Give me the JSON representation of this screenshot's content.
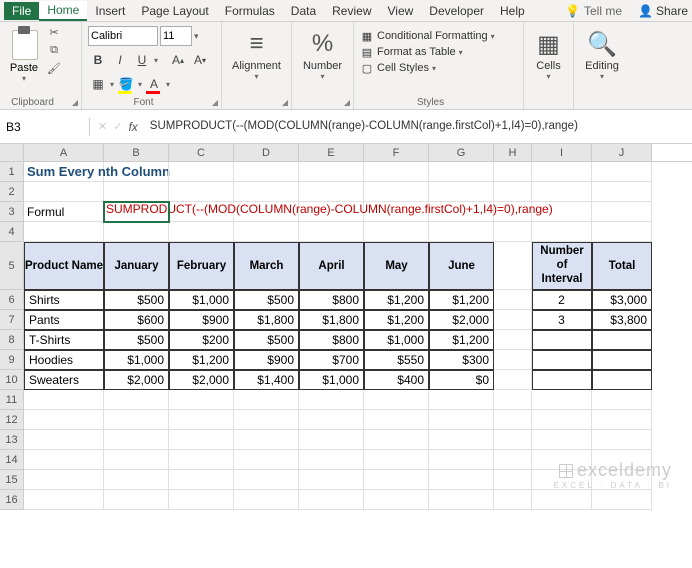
{
  "menu": {
    "file": "File",
    "home": "Home",
    "insert": "Insert",
    "pageLayout": "Page Layout",
    "formulas": "Formulas",
    "data": "Data",
    "review": "Review",
    "view": "View",
    "developer": "Developer",
    "help": "Help",
    "tellMe": "Tell me",
    "share": "Share"
  },
  "ribbon": {
    "clipboard": {
      "label": "Clipboard",
      "paste": "Paste"
    },
    "font": {
      "label": "Font",
      "name": "Calibri",
      "size": "11"
    },
    "alignment": {
      "label": "Alignment"
    },
    "number": {
      "label": "Number"
    },
    "styles": {
      "label": "Styles",
      "cond": "Conditional Formatting",
      "table": "Format as Table",
      "cell": "Cell Styles"
    },
    "cells": {
      "label": "Cells"
    },
    "editing": {
      "label": "Editing"
    }
  },
  "namebox": "B3",
  "formulaBar": "SUMPRODUCT(--(MOD(COLUMN(range)-COLUMN(range.firstCol)+1,I4)=0),range)",
  "sheet": {
    "cols": [
      "A",
      "B",
      "C",
      "D",
      "E",
      "F",
      "G",
      "H",
      "I",
      "J"
    ],
    "title": "Sum Every nth Column",
    "formulaLabel": "Formul",
    "formulaCell": "SUMPRODUCT(--(MOD(COLUMN(range)-COLUMN(range.firstCol)+1,I4)=0),range)",
    "headers": {
      "product": "Product Name",
      "months": [
        "January",
        "February",
        "March",
        "April",
        "May",
        "June"
      ],
      "interval": "Number of Interval",
      "total": "Total"
    },
    "rows": [
      {
        "name": "Shirts",
        "vals": [
          "$500",
          "$1,000",
          "$500",
          "$800",
          "$1,200",
          "$1,200"
        ]
      },
      {
        "name": "Pants",
        "vals": [
          "$600",
          "$900",
          "$1,800",
          "$1,800",
          "$1,200",
          "$2,000"
        ]
      },
      {
        "name": "T-Shirts",
        "vals": [
          "$500",
          "$200",
          "$500",
          "$800",
          "$1,000",
          "$1,200"
        ]
      },
      {
        "name": "Hoodies",
        "vals": [
          "$1,000",
          "$1,200",
          "$900",
          "$700",
          "$550",
          "$300"
        ]
      },
      {
        "name": "Sweaters",
        "vals": [
          "$2,000",
          "$2,000",
          "$1,400",
          "$1,000",
          "$400",
          "$0"
        ]
      }
    ],
    "side": [
      {
        "interval": "2",
        "total": "$3,000"
      },
      {
        "interval": "3",
        "total": "$3,800"
      }
    ]
  },
  "watermark": {
    "main": "exceldemy",
    "sub": "EXCEL · DATA · BI"
  },
  "chart_data": {
    "type": "table",
    "title": "Sum Every nth Column",
    "categories": [
      "January",
      "February",
      "March",
      "April",
      "May",
      "June"
    ],
    "series": [
      {
        "name": "Shirts",
        "values": [
          500,
          1000,
          500,
          800,
          1200,
          1200
        ]
      },
      {
        "name": "Pants",
        "values": [
          600,
          900,
          1800,
          1800,
          1200,
          2000
        ]
      },
      {
        "name": "T-Shirts",
        "values": [
          500,
          200,
          500,
          800,
          1000,
          1200
        ]
      },
      {
        "name": "Hoodies",
        "values": [
          1000,
          1200,
          900,
          700,
          550,
          300
        ]
      },
      {
        "name": "Sweaters",
        "values": [
          2000,
          2000,
          1400,
          1000,
          400,
          0
        ]
      }
    ],
    "summary": {
      "interval_2_total": 3000,
      "interval_3_total": 3800
    }
  }
}
